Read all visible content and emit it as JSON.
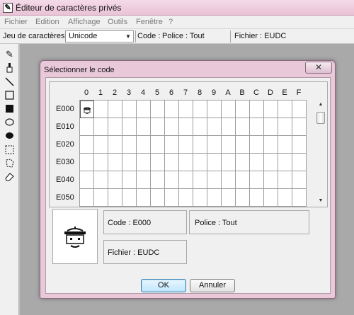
{
  "window": {
    "title": "Éditeur de caractères privés",
    "icon": "pencil-edit-icon"
  },
  "menu": [
    "Fichier",
    "Edition",
    "Affichage",
    "Outils",
    "Fenêtre",
    "?"
  ],
  "toolbar": {
    "charset_label": "Jeu de caractères :",
    "charset_value": "Unicode",
    "code_label": "Code :",
    "police_label": "Police : Tout",
    "fichier_label": "Fichier : EUDC"
  },
  "tools": [
    "pencil-icon",
    "brush-icon",
    "line-icon",
    "rectangle-outline-icon",
    "rectangle-filled-icon",
    "ellipse-outline-icon",
    "ellipse-filled-icon",
    "rectangle-select-icon",
    "freeform-select-icon",
    "eraser-icon"
  ],
  "dialog": {
    "title": "Sélectionner le code",
    "close_label": "✕",
    "column_headers": [
      "0",
      "1",
      "2",
      "3",
      "4",
      "5",
      "6",
      "7",
      "8",
      "9",
      "A",
      "B",
      "C",
      "D",
      "E",
      "F"
    ],
    "row_headers": [
      "E000",
      "E010",
      "E020",
      "E030",
      "E040",
      "E050"
    ],
    "selected_code": "E000",
    "code_label": "Code :   E000",
    "police_label": "Police :  Tout",
    "fichier_label": "Fichier :  EUDC",
    "ok_label": "OK",
    "cancel_label": "Annuler"
  },
  "colors": {
    "title_bar": "#eac2d6",
    "dialog_frame": "#e9c8da",
    "client_bg": "#f0f0f0",
    "workspace": "#a9a9a9"
  }
}
